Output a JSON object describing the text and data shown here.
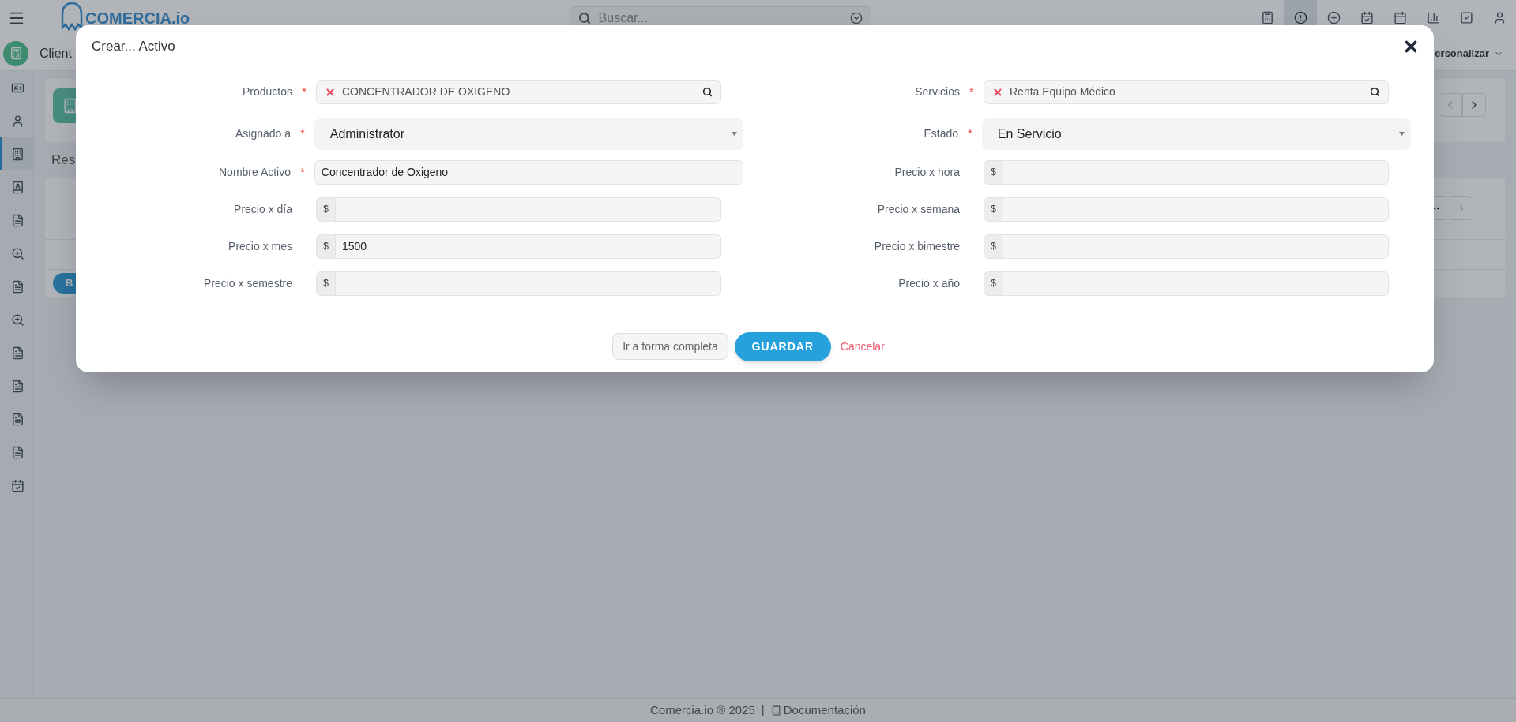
{
  "topbar": {
    "logo": "COMERCIA.io",
    "search": {
      "placeholder": "Buscar..."
    },
    "icons": [
      {
        "selected": false
      },
      {
        "selected": true
      },
      {
        "selected": false
      },
      {
        "selected": false
      },
      {
        "selected": false
      },
      {
        "selected": false
      },
      {
        "selected": false
      },
      {
        "selected": false
      }
    ]
  },
  "subbar": {
    "breadcrumb": "Client",
    "customize": "ersonalizar"
  },
  "sidebar": {
    "items": [
      {
        "selected": false
      },
      {
        "selected": false
      },
      {
        "selected": true
      },
      {
        "selected": false
      },
      {
        "selected": false
      },
      {
        "selected": false
      },
      {
        "selected": false
      },
      {
        "selected": false
      },
      {
        "selected": false
      },
      {
        "selected": false
      },
      {
        "selected": false
      },
      {
        "selected": false
      },
      {
        "selected": false
      }
    ]
  },
  "main": {
    "tab": "Res",
    "button": "B"
  },
  "modal": {
    "title": "Crear... Activo",
    "left_fields": [
      {
        "label": "Productos",
        "required": true,
        "kind": "lookup",
        "value": "CONCENTRADOR DE OXIGENO"
      },
      {
        "label": "Asignado a",
        "required": true,
        "kind": "select",
        "value": "Administrator"
      },
      {
        "label": "Nombre Activo",
        "required": true,
        "kind": "text",
        "value": "Concentrador de Oxigeno"
      },
      {
        "label": "Precio x día",
        "required": false,
        "kind": "money",
        "prefix": "$"
      },
      {
        "label": "Precio x mes",
        "required": false,
        "kind": "money",
        "prefix": "$",
        "value": "1500"
      },
      {
        "label": "Precio x semestre",
        "required": false,
        "kind": "money",
        "prefix": "$"
      }
    ],
    "right_fields": [
      {
        "label": "Servicios",
        "required": true,
        "kind": "lookup",
        "value": "Renta Equipo Médico"
      },
      {
        "label": "Estado",
        "required": true,
        "kind": "select",
        "value": "En Servicio"
      },
      {
        "label": "Precio x hora",
        "required": false,
        "kind": "money",
        "prefix": "$"
      },
      {
        "label": "Precio x semana",
        "required": false,
        "kind": "money",
        "prefix": "$"
      },
      {
        "label": "Precio x bimestre",
        "required": false,
        "kind": "money",
        "prefix": "$"
      },
      {
        "label": "Precio x año",
        "required": false,
        "kind": "money",
        "prefix": "$"
      }
    ],
    "star": "*",
    "buttons": {
      "full_form": "Ir a forma completa",
      "save": "GUARDAR",
      "cancel": "Cancelar"
    }
  },
  "footer": {
    "copyright": "Comercia.io ® 2025",
    "separator": "|",
    "link": "Documentación"
  }
}
